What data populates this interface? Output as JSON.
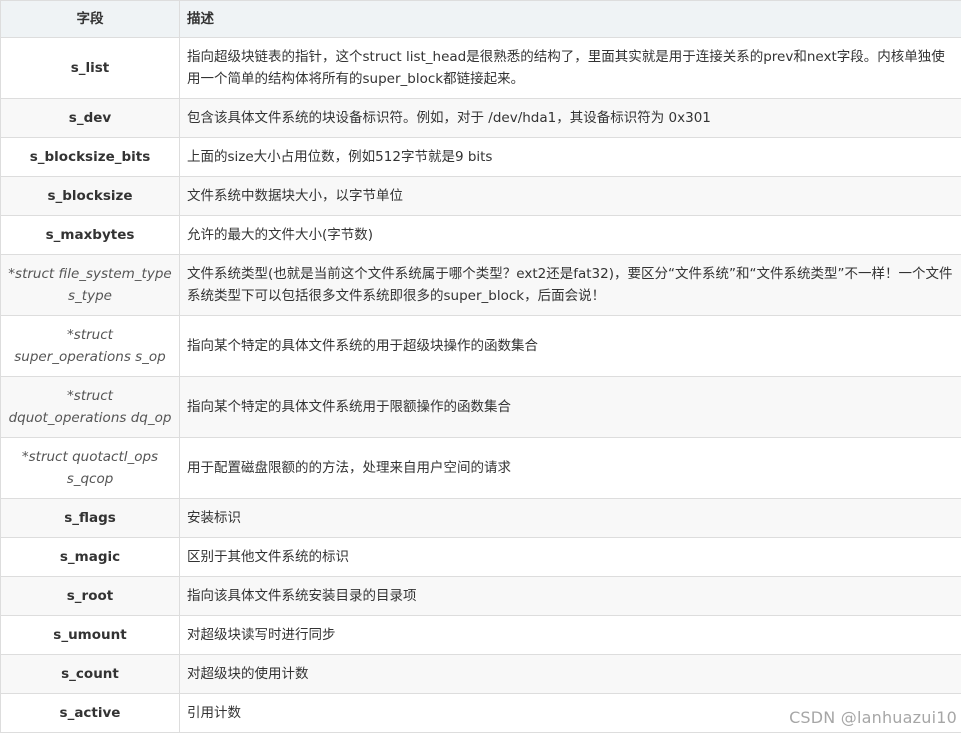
{
  "table": {
    "headers": [
      "字段",
      "描述"
    ],
    "rows": [
      {
        "field": "s_list",
        "desc": "指向超级块链表的指针，这个struct list_head是很熟悉的结构了，里面其实就是用于连接关系的prev和next字段。内核单独使用一个简单的结构体将所有的super_block都链接起来。"
      },
      {
        "field": "s_dev",
        "desc": "包含该具体文件系统的块设备标识符。例如，对于 /dev/hda1，其设备标识符为 0x301"
      },
      {
        "field": "s_blocksize_bits",
        "desc": "上面的size大小占用位数，例如512字节就是9 bits"
      },
      {
        "field": "s_blocksize",
        "desc": "文件系统中数据块大小，以字节单位"
      },
      {
        "field": "s_maxbytes",
        "desc": "允许的最大的文件大小(字节数)"
      },
      {
        "field": "*struct file_system_type s_type",
        "desc": "文件系统类型(也就是当前这个文件系统属于哪个类型？ext2还是fat32)，要区分“文件系统”和“文件系统类型”不一样！一个文件系统类型下可以包括很多文件系统即很多的super_block，后面会说！"
      },
      {
        "field": "*struct super_operations s_op",
        "desc": "指向某个特定的具体文件系统的用于超级块操作的函数集合"
      },
      {
        "field": "*struct dquot_operations dq_op",
        "desc": "指向某个特定的具体文件系统用于限额操作的函数集合"
      },
      {
        "field": "*struct quotactl_ops s_qcop",
        "desc": "用于配置磁盘限额的的方法，处理来自用户空间的请求"
      },
      {
        "field": "s_flags",
        "desc": "安装标识"
      },
      {
        "field": "s_magic",
        "desc": "区别于其他文件系统的标识"
      },
      {
        "field": "s_root",
        "desc": "指向该具体文件系统安装目录的目录项"
      },
      {
        "field": "s_umount",
        "desc": "对超级块读写时进行同步"
      },
      {
        "field": "s_count",
        "desc": "对超级块的使用计数"
      },
      {
        "field": "s_active",
        "desc": "引用计数"
      }
    ]
  },
  "watermark": "CSDN @lanhuazui10"
}
